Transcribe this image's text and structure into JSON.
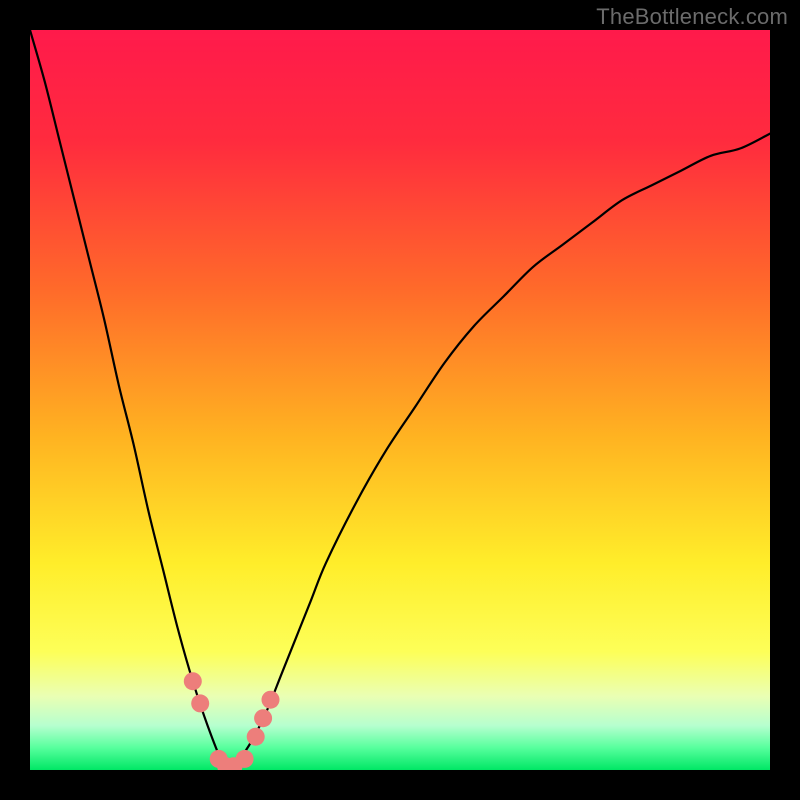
{
  "watermark": "TheBottleneck.com",
  "colors": {
    "frame": "#000000",
    "curve": "#000000",
    "marker_fill": "#ed7e7b",
    "gradient_stops": [
      {
        "pos": 0.0,
        "color": "#ff1a4b"
      },
      {
        "pos": 0.15,
        "color": "#ff2b3e"
      },
      {
        "pos": 0.35,
        "color": "#ff6a2a"
      },
      {
        "pos": 0.55,
        "color": "#ffb321"
      },
      {
        "pos": 0.72,
        "color": "#ffed2a"
      },
      {
        "pos": 0.84,
        "color": "#fdff58"
      },
      {
        "pos": 0.9,
        "color": "#eaffb3"
      },
      {
        "pos": 0.94,
        "color": "#b6ffcf"
      },
      {
        "pos": 0.97,
        "color": "#57ff9d"
      },
      {
        "pos": 1.0,
        "color": "#00e765"
      }
    ]
  },
  "chart_data": {
    "type": "line",
    "title": "",
    "xlabel": "",
    "ylabel": "",
    "xlim": [
      0,
      100
    ],
    "ylim": [
      0,
      100
    ],
    "grid": false,
    "notes": "V-shaped bottleneck curve. x is relative component strength (0–100), y is bottleneck severity % (0 = perfect match, 100 = full bottleneck). Minimum around x≈27.",
    "x": [
      0,
      2,
      4,
      6,
      8,
      10,
      12,
      14,
      16,
      18,
      20,
      22,
      24,
      26,
      27,
      28,
      30,
      32,
      34,
      36,
      38,
      40,
      44,
      48,
      52,
      56,
      60,
      64,
      68,
      72,
      76,
      80,
      84,
      88,
      92,
      96,
      100
    ],
    "values": [
      100,
      93,
      85,
      77,
      69,
      61,
      52,
      44,
      35,
      27,
      19,
      12,
      6,
      1,
      0,
      1,
      4,
      8,
      13,
      18,
      23,
      28,
      36,
      43,
      49,
      55,
      60,
      64,
      68,
      71,
      74,
      77,
      79,
      81,
      83,
      84,
      86
    ],
    "ideal_x": 27,
    "markers": [
      {
        "x": 22,
        "y": 12
      },
      {
        "x": 23,
        "y": 9
      },
      {
        "x": 25.5,
        "y": 1.5
      },
      {
        "x": 26.5,
        "y": 0.5
      },
      {
        "x": 27.5,
        "y": 0.5
      },
      {
        "x": 29,
        "y": 1.5
      },
      {
        "x": 30.5,
        "y": 4.5
      },
      {
        "x": 31.5,
        "y": 7
      },
      {
        "x": 32.5,
        "y": 9.5
      }
    ]
  }
}
